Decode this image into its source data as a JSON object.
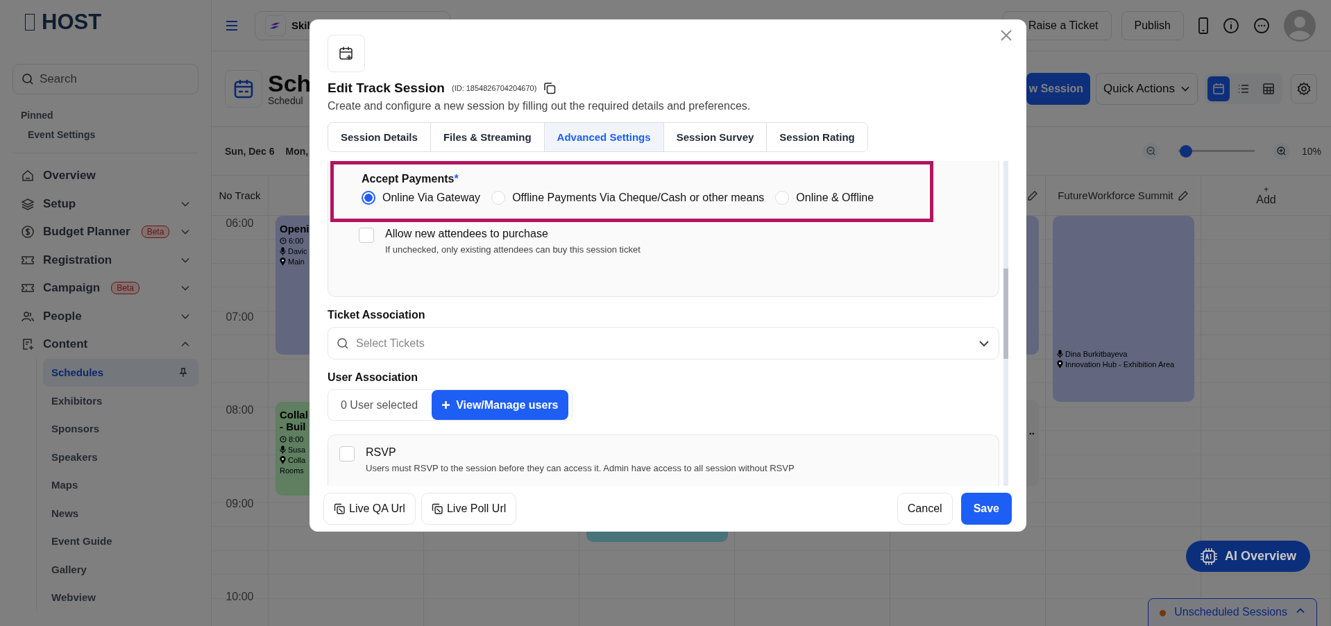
{
  "sidebar": {
    "logo": "HOST",
    "search": {
      "placeholder": "Search"
    },
    "pinned_label": "Pinned",
    "pinned": [
      "Event Settings"
    ],
    "nav": [
      {
        "label": "Overview"
      },
      {
        "label": "Setup",
        "expanded": false
      },
      {
        "label": "Budget Planner",
        "badge": "Beta",
        "expanded": false
      },
      {
        "label": "Registration",
        "expanded": false
      },
      {
        "label": "Campaign",
        "badge": "Beta",
        "expanded": false
      },
      {
        "label": "People",
        "expanded": false
      },
      {
        "label": "Content",
        "expanded": true,
        "children": [
          {
            "label": "Schedules",
            "selected": true
          },
          {
            "label": "Exhibitors",
            "selected": false
          },
          {
            "label": "Sponsors",
            "selected": false
          },
          {
            "label": "Speakers",
            "selected": false
          },
          {
            "label": "Maps",
            "selected": false
          },
          {
            "label": "News",
            "selected": false
          },
          {
            "label": "Event Guide",
            "selected": false
          },
          {
            "label": "Gallery",
            "selected": false
          },
          {
            "label": "Webview",
            "selected": false
          }
        ]
      }
    ]
  },
  "topbar": {
    "event_selector": "Skil",
    "buttons": [
      "Raise a Ticket",
      "Publish"
    ]
  },
  "header": {
    "title": "Sch",
    "subtitle": "Schedul",
    "new_session": "w Session",
    "quick_actions": "Quick Actions",
    "views": [
      {
        "kind": "calendar",
        "selected": true
      },
      {
        "kind": "list",
        "selected": false
      },
      {
        "kind": "table",
        "selected": false
      }
    ]
  },
  "datebar": {
    "days": [
      "Sun, Dec 6",
      "Mon,"
    ],
    "zoom": {
      "level": 0.02,
      "reading": "10%"
    }
  },
  "calendar": {
    "corner_label": "No Track",
    "tracks": [
      {
        "name": "FutureWorkforce Summit"
      }
    ],
    "add_icon": "+",
    "add_label": "Add",
    "times": [
      "06:00",
      "07:00",
      "08:00",
      "09:00",
      "10:00"
    ],
    "events": [
      {
        "color": "#62677f",
        "title": [
          "Openi"
        ],
        "time": "6:00",
        "speaker": "Davic",
        "location": "Main"
      },
      {
        "color": "#5f7f60",
        "title": [
          "Collal",
          "- Buil"
        ],
        "time": "8:00",
        "speaker": "Susa",
        "location": "Colla",
        "extra": "Rooms"
      },
      {
        "color": "#62677f"
      },
      {
        "color": "#62677f",
        "speaker": "Dina Burkitbayeva",
        "location": "Innovation Hub - Exhibition Area"
      },
      {
        "color": "#7a7a7a",
        "title": [
          ".."
        ]
      },
      {
        "color": "#47737a"
      }
    ]
  },
  "ai_button": "AI Overview",
  "unscheduled": {
    "label": "Unscheduled Sessions",
    "color": "#70380e"
  },
  "modal": {
    "title": "Edit Track Session",
    "id": "(ID: 1854826704204670)",
    "description": "Create and configure a new session by filling out the required details and preferences.",
    "tabs": [
      {
        "label": "Session Details",
        "selected": false
      },
      {
        "label": "Files & Streaming",
        "selected": false
      },
      {
        "label": "Advanced Settings",
        "selected": true
      },
      {
        "label": "Session Survey",
        "selected": false
      },
      {
        "label": "Session Rating",
        "selected": false
      }
    ],
    "payments": {
      "label": "Accept Payments",
      "required_mark": "*",
      "options": [
        {
          "label": "Online Via Gateway",
          "selected": true
        },
        {
          "label": "Offline Payments Via Cheque/Cash or other means",
          "selected": false
        },
        {
          "label": "Online & Offline",
          "selected": false
        }
      ]
    },
    "allow_purchase": {
      "label": "Allow new attendees to purchase",
      "hint": "If unchecked, only existing attendees can buy this session ticket",
      "checked": false
    },
    "ticket_association": {
      "label": "Ticket Association",
      "placeholder": "Select Tickets"
    },
    "user_association": {
      "label": "User Association",
      "count": "0 User selected",
      "button": "View/Manage users"
    },
    "rsvp": {
      "label": "RSVP",
      "hint": "Users must RSVP to the session before they can access it. Admin have access to all session without RSVP",
      "checked": false
    },
    "footer_links": [
      "Live QA Url",
      "Live Poll Url"
    ],
    "cancel": "Cancel",
    "save": "Save"
  }
}
